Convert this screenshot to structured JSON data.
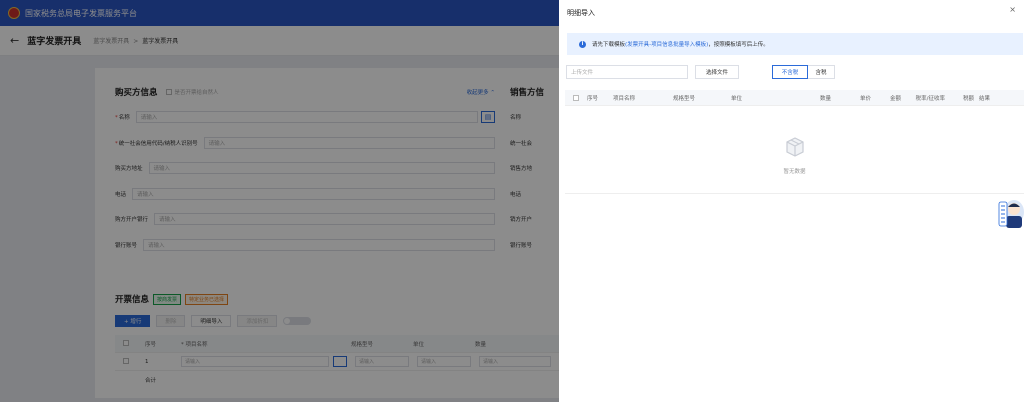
{
  "app": {
    "title": "国家税务总局电子发票服务平台"
  },
  "header": {
    "back_icon": "arrow-left-icon",
    "title": "蓝字发票开具",
    "breadcrumb": [
      "蓝字发票开具",
      "蓝字发票开具"
    ]
  },
  "buyer": {
    "title": "购买方信息",
    "natural_person_label": "是否开票给自然人",
    "expand_label": "收起更多",
    "fields": [
      {
        "label": "名称",
        "required": true,
        "placeholder": "请输入",
        "has_button": true
      },
      {
        "label": "统一社会信用代码/纳税人识别号",
        "required": true,
        "placeholder": "请输入",
        "has_button": false
      },
      {
        "label": "购买方地址",
        "required": false,
        "placeholder": "请输入",
        "has_button": false
      },
      {
        "label": "电话",
        "required": false,
        "placeholder": "请输入",
        "has_button": false
      },
      {
        "label": "购方开户银行",
        "required": false,
        "placeholder": "请输入",
        "has_button": false
      },
      {
        "label": "银行账号",
        "required": false,
        "placeholder": "请输入",
        "has_button": false
      }
    ]
  },
  "seller": {
    "title": "销售方信",
    "fields": [
      "名称",
      "统一社会",
      "销售方地",
      "电话",
      "销方开户",
      "银行账号"
    ]
  },
  "invoice": {
    "title": "开票信息",
    "tags": [
      "按商发票",
      "特定业务已选择"
    ],
    "buttons": [
      "+ 增行",
      "删除",
      "明细导入",
      "添加折扣"
    ],
    "table_headers": [
      "序号",
      "* 项目名称",
      "规格型号",
      "单位",
      "数量"
    ],
    "row": {
      "index": "1",
      "placeholder": "请输入"
    },
    "total_label": "合计"
  },
  "drawer": {
    "title": "明细导入",
    "close_icon": "close-icon",
    "info": {
      "prefix": "请先下载模板",
      "link": "(发票开具-项目信息批量导入模板)",
      "suffix": "，按照模板填写后上传。"
    },
    "upload_placeholder": "上传文件",
    "choose_file_label": "选择文件",
    "tax_options": [
      "不含税",
      "含税"
    ],
    "selected_tax_option": "不含税",
    "table_headers": [
      "序号",
      "项目名称",
      "规格型号",
      "单位",
      "数量",
      "单价",
      "金额",
      "税率/征收率",
      "税额",
      "结果"
    ],
    "empty_text": "暂无数据"
  },
  "colors": {
    "primary": "#2b6bd9",
    "topbar": "#2b56c4",
    "info_bg": "#e8f1ff"
  }
}
